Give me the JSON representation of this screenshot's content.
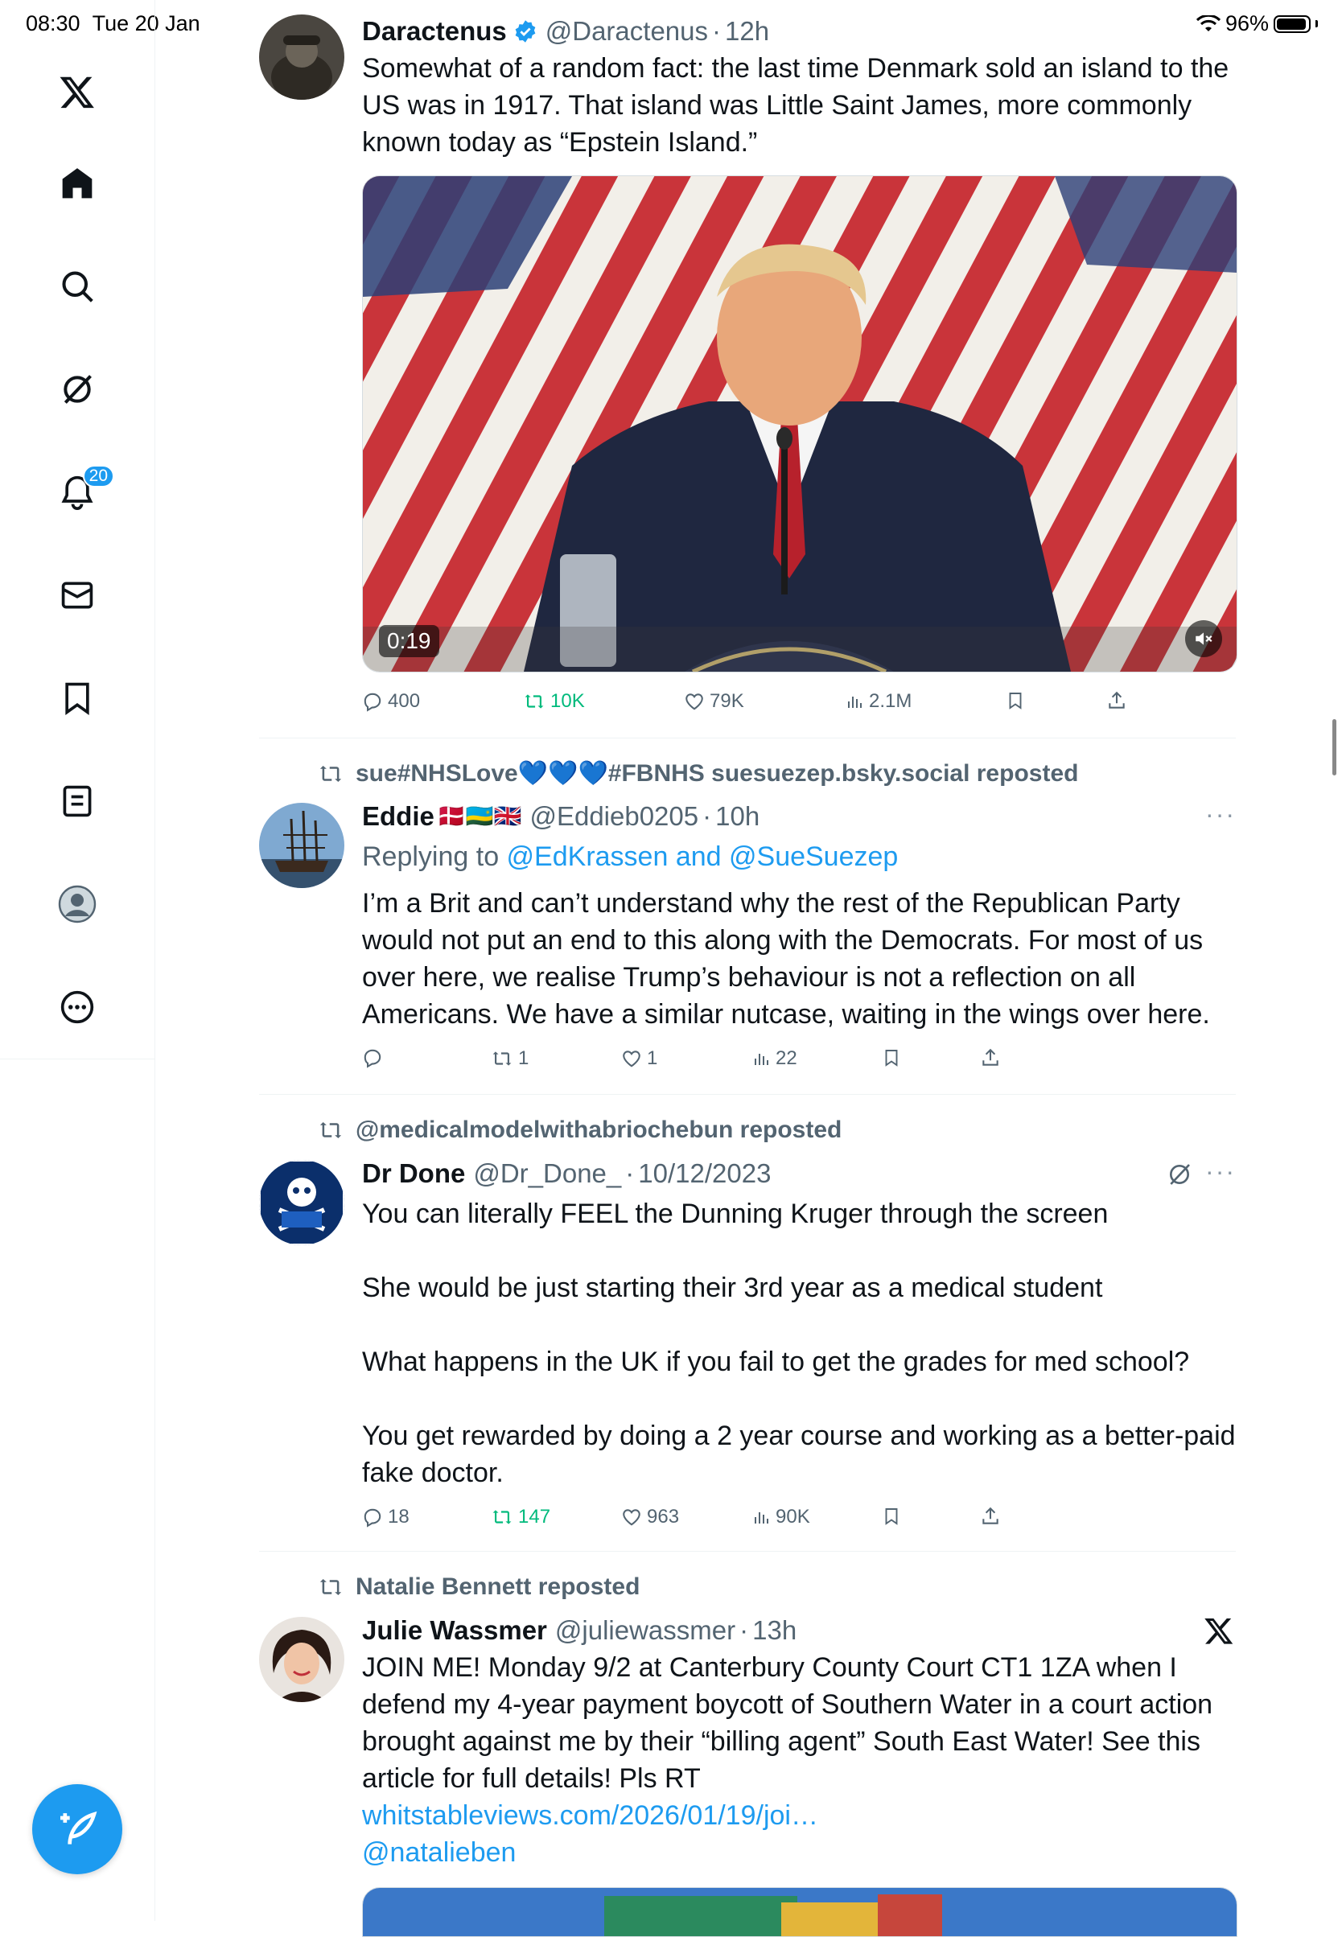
{
  "status_bar": {
    "time": "08:30",
    "date": "Tue 20 Jan",
    "battery": "96%"
  },
  "sidebar": {
    "items": [
      {
        "name": "x-logo-icon"
      },
      {
        "name": "home-icon"
      },
      {
        "name": "search-icon"
      },
      {
        "name": "grok-icon"
      },
      {
        "name": "notifications-icon",
        "badge": "20"
      },
      {
        "name": "messages-icon"
      },
      {
        "name": "bookmarks-icon"
      },
      {
        "name": "lists-icon"
      },
      {
        "name": "profile-icon"
      },
      {
        "name": "more-icon"
      }
    ],
    "compose_icon": "compose-icon"
  },
  "colors": {
    "accent": "#1d9bf0",
    "muted": "#536471",
    "retweet_active": "#00ba7c",
    "border": "#eff3f4"
  },
  "tweets": [
    {
      "name": "Daractenus",
      "handle": "@Daractenus",
      "time": "12h",
      "verified": true,
      "text": "Somewhat of a random fact: the last time Denmark sold an island to the US was in 1917. That island was Little Saint James, more commonly known today as “Epstein Island.”",
      "video_duration": "0:19",
      "stats": {
        "replies": "400",
        "reposts": "10K",
        "likes": "79K",
        "views": "2.1M"
      }
    },
    {
      "repost_by": "sue#NHSLove💙💙💙#FBNHS suesuezep.bsky.social reposted",
      "name": "Eddie",
      "flags": "🇩🇰🇷🇼🇬🇧",
      "handle": "@Eddieb0205",
      "time": "10h",
      "reply_prefix": "Replying to ",
      "reply_to": "@EdKrassen and @SueSuezep",
      "text": "I’m a Brit and can’t understand why the rest of the Republican Party would not put an end to this along with the Democrats. For most of us over here, we realise Trump’s behaviour is not a reflection on all Americans. We have a similar nutcase, waiting in the wings over here.",
      "stats": {
        "replies": "",
        "reposts": "1",
        "likes": "1",
        "views": "22"
      }
    },
    {
      "repost_by": "@medicalmodelwithabriochebun reposted",
      "name": "Dr Done",
      "handle": "@Dr_Done_",
      "time": "10/12/2023",
      "paragraphs": [
        "You can literally FEEL the Dunning Kruger through the screen",
        "She would be just starting their 3rd year as a medical student",
        "What happens in the UK if you fail to get the grades for med school?",
        "You get rewarded by doing a 2 year course and working as a better-paid fake doctor."
      ],
      "stats": {
        "replies": "18",
        "reposts": "147",
        "likes": "963",
        "views": "90K"
      }
    },
    {
      "repost_by": "Natalie Bennett reposted",
      "name": "Julie Wassmer",
      "handle": "@juliewassmer",
      "time": "13h",
      "text": "JOIN ME! Monday 9/2 at Canterbury County Court CT1 1ZA when I defend my 4-year payment boycott of Southern Water in a court action brought against me by their “billing agent” South East Water! See this article for full details! Pls RT",
      "link": "whitstableviews.com/2026/01/19/joi…",
      "mention": "@natalieben"
    }
  ]
}
